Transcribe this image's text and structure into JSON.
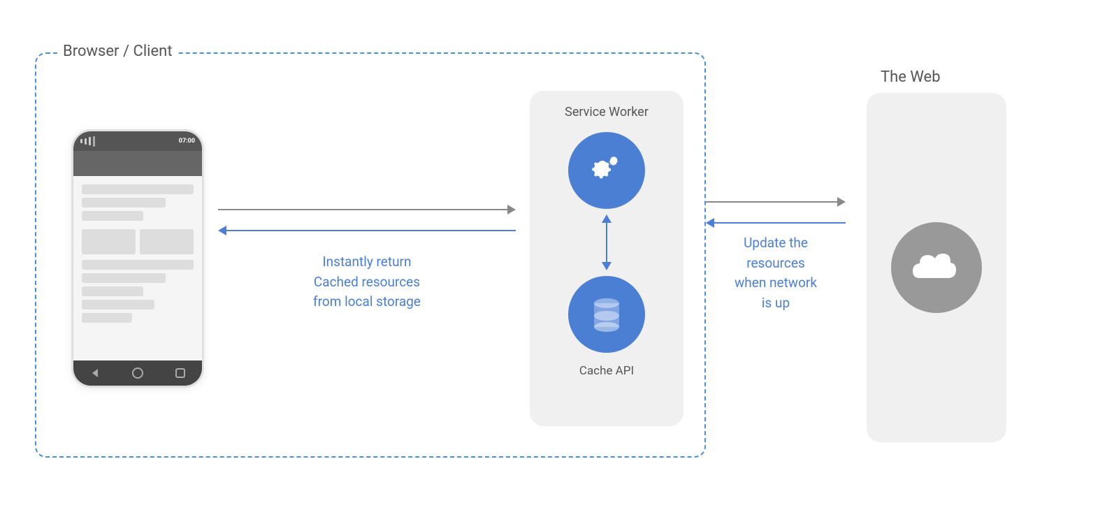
{
  "labels": {
    "browser_client": "Browser / Client",
    "the_web": "The Web",
    "service_worker": "Service Worker",
    "cache_api": "Cache API",
    "instantly_return": "Instantly return",
    "cached_resources": "Cached resources",
    "from_local_storage": "from local storage",
    "update_the": "Update the",
    "resources": "resources",
    "when_network": "when network",
    "is_up": "is up"
  },
  "colors": {
    "blue": "#4A7FD4",
    "arrow_gray": "#888888",
    "box_bg": "#f0f0f0",
    "phone_dark": "#555555",
    "cloud_gray": "#999999"
  }
}
